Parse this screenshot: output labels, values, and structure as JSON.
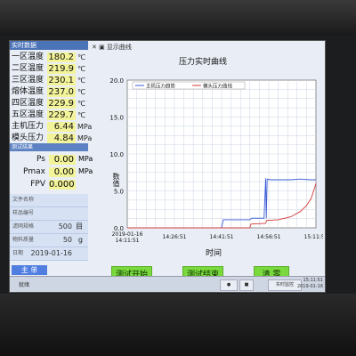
{
  "left_panel": {
    "title": "实时数据",
    "rows": [
      {
        "label": "一区温度",
        "value": "180.2",
        "unit": "℃"
      },
      {
        "label": "二区温度",
        "value": "219.9",
        "unit": "℃"
      },
      {
        "label": "三区温度",
        "value": "230.1",
        "unit": "℃"
      },
      {
        "label": "熔体温度",
        "value": "237.0",
        "unit": "℃"
      },
      {
        "label": "四区温度",
        "value": "229.9",
        "unit": "℃"
      },
      {
        "label": "五区温度",
        "value": "229.7",
        "unit": "℃"
      },
      {
        "label": "主机压力",
        "value": "6.44",
        "unit": "MPa"
      },
      {
        "label": "模头压力",
        "value": "4.84",
        "unit": "MPa"
      }
    ],
    "result_title": "测试结果",
    "results": [
      {
        "label": "Ps",
        "value": "0.00",
        "unit": "MPa"
      },
      {
        "label": "Pmax",
        "value": "0.00",
        "unit": "MPa"
      },
      {
        "label": "FPV",
        "value": "0.000",
        "unit": ""
      }
    ],
    "info": [
      {
        "label": "文件名称",
        "value": "",
        "unit": ""
      },
      {
        "label": "样品编号",
        "value": "",
        "unit": ""
      },
      {
        "label": "滤网规格",
        "value": "500",
        "unit": "目"
      },
      {
        "label": "物料质量",
        "value": "50",
        "unit": "g"
      },
      {
        "label": "日期",
        "value": "2019-01-16",
        "unit": ""
      }
    ],
    "tab_label": "主 单"
  },
  "toolbar": {
    "label": "✕ ▣ 显示曲线"
  },
  "chart_data": {
    "type": "line",
    "title": "压力实时曲线",
    "xlabel": "时间",
    "ylabel": "数值",
    "ylim": [
      0,
      20
    ],
    "yticks": [
      "20.0",
      "15.0",
      "10.0",
      "5.0",
      "0.0"
    ],
    "xticks": [
      "2019-01-16\n14:11:51",
      "14:26:51",
      "14:41:51",
      "14:56:51",
      "15:11:51"
    ],
    "legend": [
      "主机压力趋势",
      "模头压力曲线"
    ],
    "grid": true,
    "series": [
      {
        "name": "主机压力趋势",
        "color": "#3a5bd6",
        "x_minutes": [
          0,
          30,
          30.5,
          39,
          39.5,
          43.5,
          44,
          44.2,
          44.5,
          45.5,
          49,
          52,
          55,
          58,
          60
        ],
        "values": [
          0.0,
          0.0,
          1.1,
          1.1,
          1.3,
          1.3,
          6.7,
          1.3,
          6.6,
          6.5,
          6.5,
          6.5,
          6.6,
          6.5,
          6.5
        ]
      },
      {
        "name": "模头压力曲线",
        "color": "#d23a3a",
        "x_minutes": [
          0,
          39,
          39.3,
          44,
          44.3,
          48,
          52,
          55,
          57,
          58.5,
          60
        ],
        "values": [
          0.0,
          0.0,
          0.5,
          0.6,
          1.0,
          1.1,
          1.5,
          2.2,
          3.0,
          4.0,
          6.0
        ]
      }
    ]
  },
  "buttons": {
    "start": "测试开始",
    "stop": "测试结束",
    "clear": "清 零"
  },
  "statusbar": {
    "left": "就绪",
    "mode": "实时监控",
    "time": "15:11:51",
    "date": "2019-01-16"
  }
}
